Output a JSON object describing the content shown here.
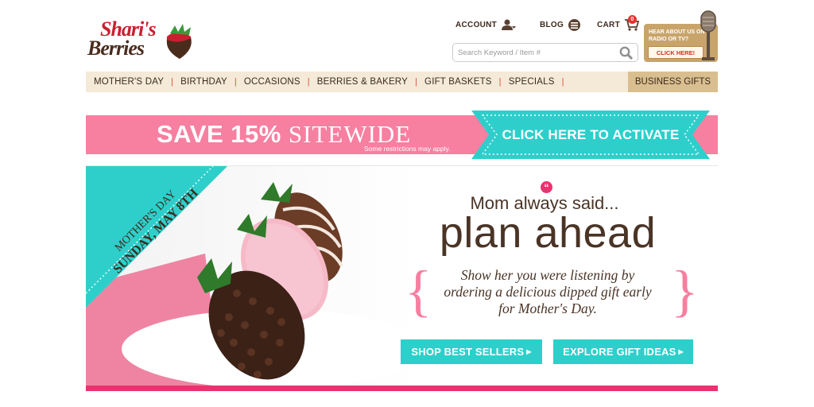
{
  "brand": {
    "line1": "Shari's",
    "line2": "Berries",
    "colors": {
      "red": "#c8202f",
      "brown": "#4a2c1c",
      "pink": "#f77fa0",
      "teal": "#2ecfcb",
      "magenta": "#e7336f"
    }
  },
  "header": {
    "account_label": "ACCOUNT",
    "blog_label": "BLOG",
    "cart_label": "CART",
    "cart_count": "0",
    "search_placeholder": "Search Keyword / Item #",
    "radio_question": "HEAR ABOUT US ON RADIO OR TV?",
    "radio_button": "CLICK HERE!"
  },
  "nav": {
    "items": [
      {
        "label": "MOTHER'S DAY"
      },
      {
        "label": "BIRTHDAY"
      },
      {
        "label": "OCCASIONS"
      },
      {
        "label": "BERRIES & BAKERY"
      },
      {
        "label": "GIFT BASKETS"
      },
      {
        "label": "SPECIALS"
      }
    ],
    "separator": "|",
    "business_label": "BUSINESS GIFTS"
  },
  "promo": {
    "headline_bold": "SAVE 15%",
    "headline_thin": "SITEWIDE",
    "restrictions": "Some restrictions may apply.",
    "activate_label": "CLICK HERE TO ACTIVATE"
  },
  "hero": {
    "ribbon_line1": "MOTHER'S DAY",
    "ribbon_line2": "SUNDAY, MAY 8TH",
    "quote_mark": "“",
    "intro": "Mom always said...",
    "headline": "plan ahead",
    "body_line1": "Show her you were listening by",
    "body_line2": "ordering a delicious dipped gift early",
    "body_line3": "for Mother's Day.",
    "cta_primary": "SHOP BEST SELLERS",
    "cta_secondary": "EXPLORE GIFT IDEAS",
    "cta_arrow": "▶"
  }
}
